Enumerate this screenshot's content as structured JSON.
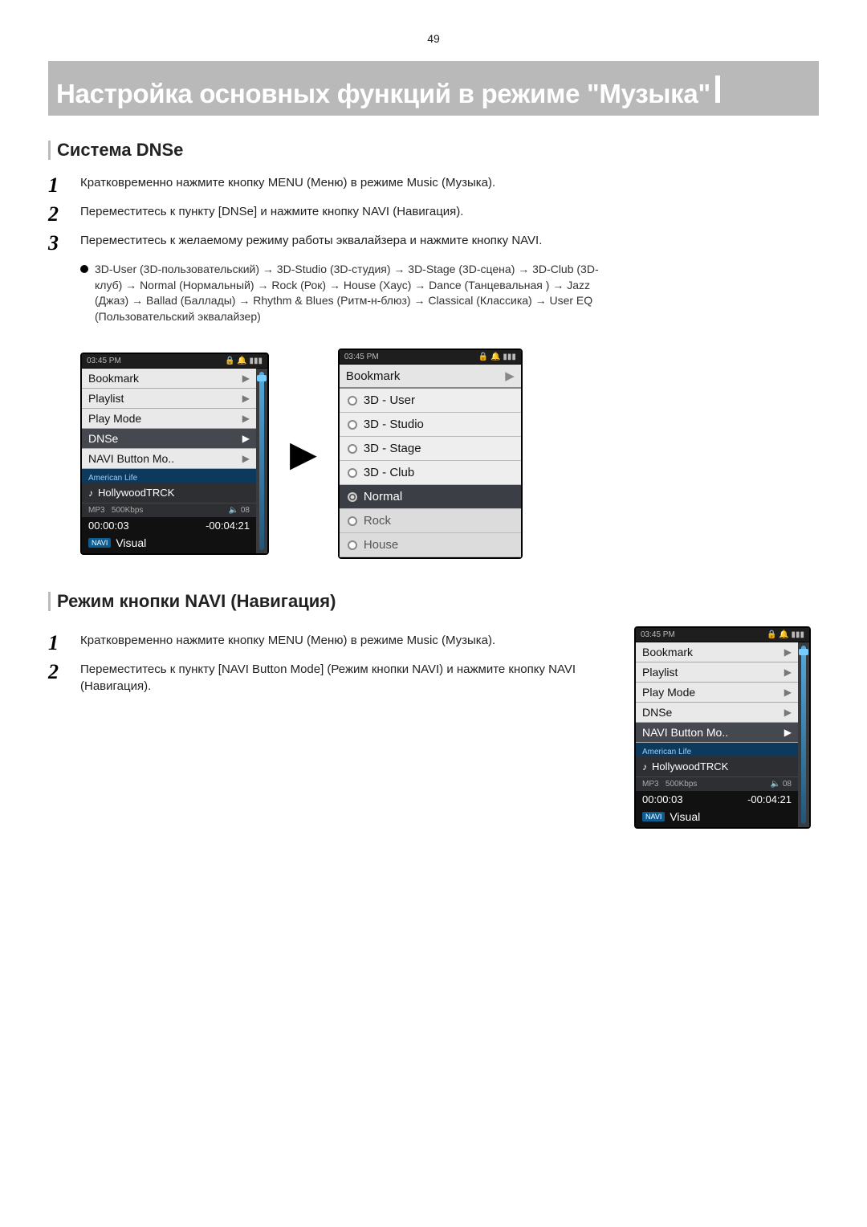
{
  "page_number": "49",
  "banner_title": "Настройка основных функций в режиме \"Музыка\"",
  "section1": {
    "heading": "Система DNSe",
    "step1": "Кратковременно нажмите кнопку MENU (Меню) в режиме Music (Музыка).",
    "step2": "Переместитесь к пункту [DNSe] и нажмите кнопку NAVI (Навигация).",
    "step3": "Переместитесь к желаемому режиму работы эквалайзера и нажмите кнопку NAVI.",
    "bullet": "3D-User (3D-пользовательский) → 3D-Studio (3D-студия) → 3D-Stage (3D-сцена) → 3D-Club (3D-клуб) → Normal (Нормальный) → Rock (Рок) → House (Хаус) → Dance (Танцевальная ) → Jazz (Джаз) → Ballad (Баллады) → Rhythm & Blues (Ритм-н-блюз) → Classical (Классика) → User EQ (Пользовательский эквалайзер)"
  },
  "device1": {
    "status_left": "03:45 PM",
    "status_right": "🔒 🔔 ▮▮▮",
    "items": {
      "bookmark": "Bookmark",
      "playlist": "Playlist",
      "playmode": "Play Mode",
      "dnse": "DNSe",
      "navibtn": "NAVI Button Mo.."
    },
    "cutoff": "American Life",
    "track": "HollywoodTRCK",
    "codec": "MP3",
    "bitrate": "500Kbps",
    "vol_icon": "🔈 08",
    "time_elapsed": "00:00:03",
    "time_remain": "-00:04:21",
    "navi_badge": "NAVI",
    "visual": "Visual"
  },
  "device2": {
    "status_left": "03:45 PM",
    "status_right": "🔒 🔔 ▮▮▮",
    "header": "Bookmark",
    "options": {
      "o1": "3D - User",
      "o2": "3D - Studio",
      "o3": "3D - Stage",
      "o4": "3D - Club",
      "o5": "Normal",
      "o6": "Rock",
      "o7": "House"
    }
  },
  "section2": {
    "heading": "Режим кнопки NAVI (Навигация)",
    "step1": "Кратковременно нажмите кнопку MENU (Меню) в режиме Music (Музыка).",
    "step2": "Переместитесь к пункту [NAVI Button Mode] (Режим кнопки NAVI) и нажмите кнопку NAVI (Навигация)."
  },
  "device3": {
    "status_left": "03:45 PM",
    "status_right": "🔒 🔔 ▮▮▮",
    "items": {
      "bookmark": "Bookmark",
      "playlist": "Playlist",
      "playmode": "Play Mode",
      "dnse": "DNSe",
      "navibtn": "NAVI Button Mo.."
    },
    "cutoff": "American Life",
    "track": "HollywoodTRCK",
    "codec": "MP3",
    "bitrate": "500Kbps",
    "vol_icon": "🔈 08",
    "time_elapsed": "00:00:03",
    "time_remain": "-00:04:21",
    "navi_badge": "NAVI",
    "visual": "Visual"
  }
}
